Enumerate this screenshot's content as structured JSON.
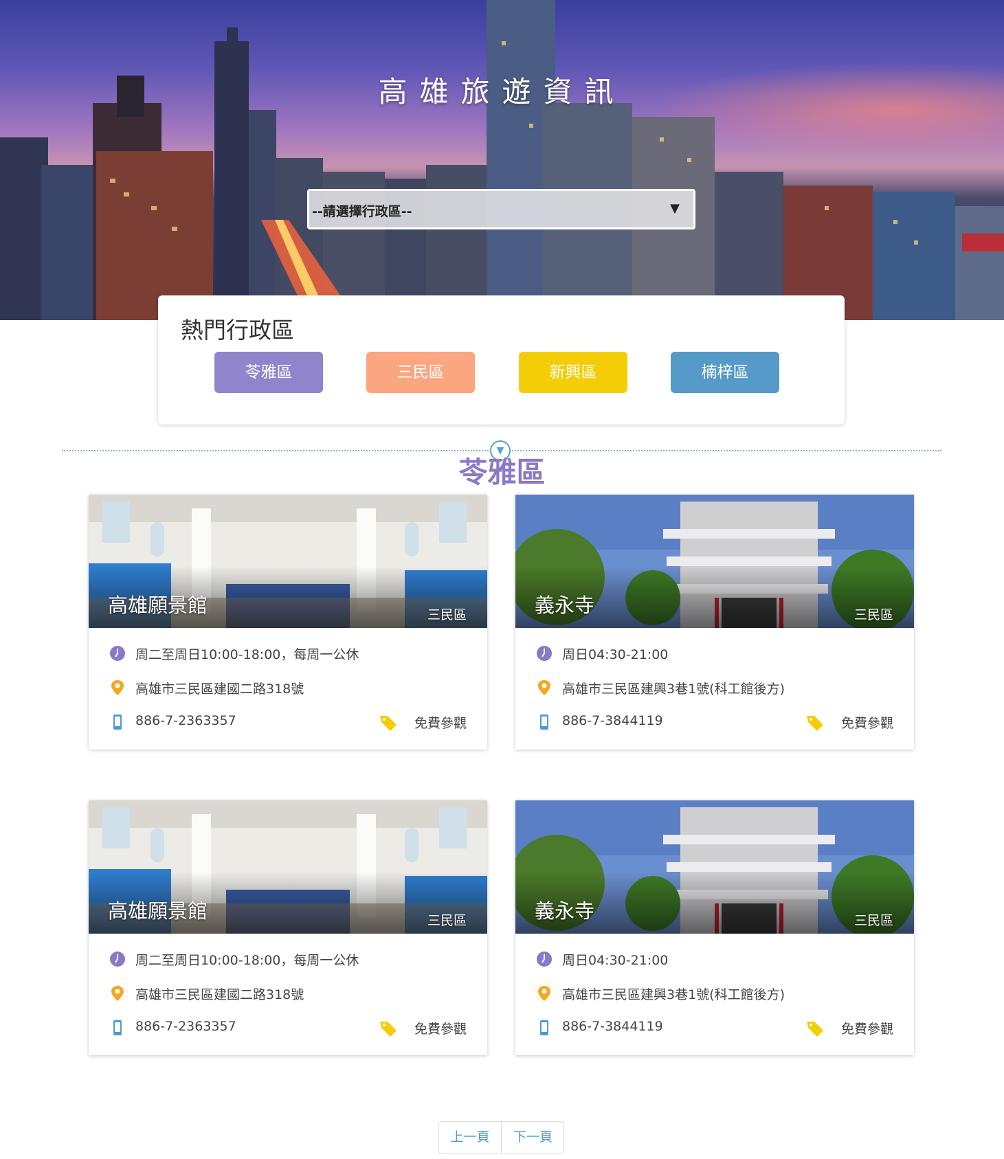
{
  "hero": {
    "title": "高雄旅遊資訊",
    "select_value": "--請選擇行政區--"
  },
  "hot_districts": {
    "title": "熱門行政區",
    "buttons": [
      {
        "label": "苓雅區",
        "color": "#9085cc"
      },
      {
        "label": "三民區",
        "color": "#fca581"
      },
      {
        "label": "新興區",
        "color": "#f4cd07"
      },
      {
        "label": "楠梓區",
        "color": "#559ac8"
      }
    ]
  },
  "section": {
    "title": "苓雅區"
  },
  "spots": [
    {
      "name": "高雄願景館",
      "district": "三民區",
      "hours": "周二至周日10:00-18:00，每周一公休",
      "address": "高雄市三民區建國二路318號",
      "phone": "886-7-2363357",
      "ticket": "免費參觀",
      "photo": "hall"
    },
    {
      "name": "義永寺",
      "district": "三民區",
      "hours": "周日04:30-21:00",
      "address": "高雄市三民區建興3巷1號(科工館後方)",
      "phone": "886-7-3844119",
      "ticket": "免費參觀",
      "photo": "temple"
    },
    {
      "name": "高雄願景館",
      "district": "三民區",
      "hours": "周二至周日10:00-18:00，每周一公休",
      "address": "高雄市三民區建國二路318號",
      "phone": "886-7-2363357",
      "ticket": "免費參觀",
      "photo": "hall"
    },
    {
      "name": "義永寺",
      "district": "三民區",
      "hours": "周日04:30-21:00",
      "address": "高雄市三民區建興3巷1號(科工館後方)",
      "phone": "886-7-3844119",
      "ticket": "免費參觀",
      "photo": "temple"
    }
  ],
  "pagination": {
    "prev_label": "上一頁",
    "next_label": "下一頁"
  },
  "icons": {
    "hours": "clock-icon",
    "address": "map-pin-icon",
    "phone": "phone-icon",
    "ticket": "tag-icon",
    "divider": "chevron-down-icon"
  },
  "colors": {
    "clock": "#8a78c8",
    "pin": "#f5a623",
    "phone": "#4a9ccf",
    "tag": "#f4cd07",
    "accent": "#8a78c8"
  }
}
